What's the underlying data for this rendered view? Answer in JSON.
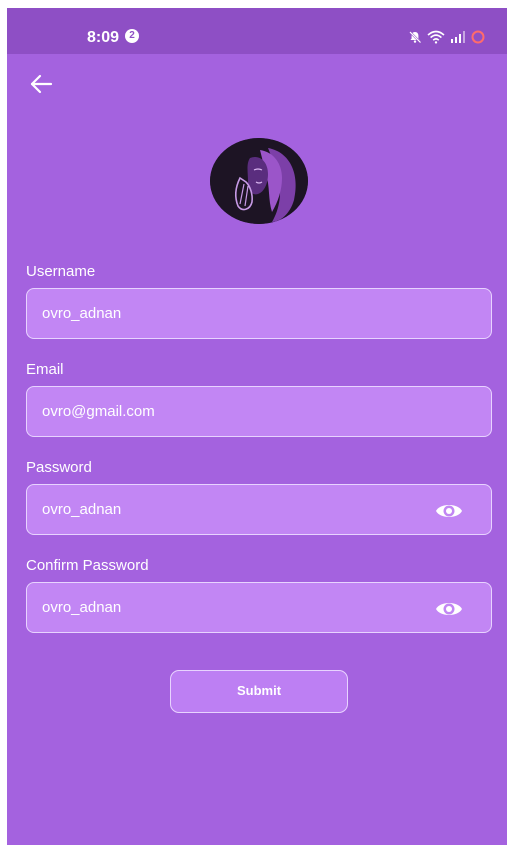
{
  "status_bar": {
    "time": "8:09",
    "notification_count": "2",
    "icons": [
      "mute-icon",
      "wifi-icon",
      "signal-icon",
      "battery-icon"
    ]
  },
  "header": {
    "back_icon": "arrow-left-icon"
  },
  "avatar": {
    "icon": "profile-illustration"
  },
  "form": {
    "username": {
      "label": "Username",
      "value": "ovro_adnan"
    },
    "email": {
      "label": "Email",
      "value": "ovro@gmail.com"
    },
    "password": {
      "label": "Password",
      "value": "ovro_adnan",
      "icon": "eye-icon"
    },
    "confirm_password": {
      "label": "Confirm Password",
      "value": "ovro_adnan",
      "icon": "eye-icon"
    },
    "submit_label": "Submit"
  },
  "colors": {
    "background": "#a462df",
    "status_bar": "#8e4fc5",
    "field_fill": "#c286f4",
    "field_border": "#e8d3ff",
    "text": "#ffffff"
  }
}
